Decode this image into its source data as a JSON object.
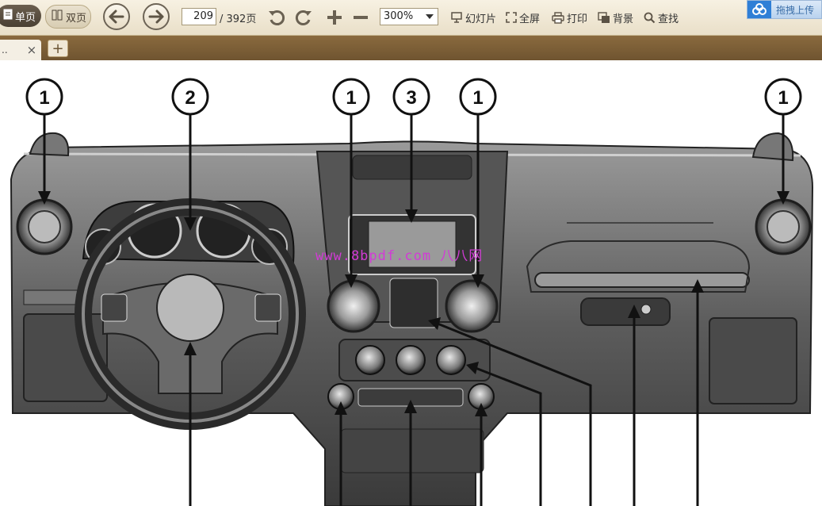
{
  "toolbar": {
    "single_page": "单页",
    "double_page": "双页",
    "current_page": "209",
    "total_pages": "/ 392页",
    "zoom": "300%",
    "slideshow": "幻灯片",
    "fullscreen": "全屏",
    "print": "打印",
    "background": "背景",
    "find": "查找",
    "upload": "拖拽上传"
  },
  "tabs": {
    "current_title": "..",
    "close": "×",
    "add": "+"
  },
  "figure": {
    "callouts": [
      "1",
      "2",
      "1",
      "3",
      "1",
      "1"
    ],
    "watermark": "www.8bpdf.com 八八网"
  },
  "colors": {
    "toolbar_bg": "#efe6d2",
    "tabbar_bg": "#7a5d35",
    "watermark": "#d23bd6"
  }
}
